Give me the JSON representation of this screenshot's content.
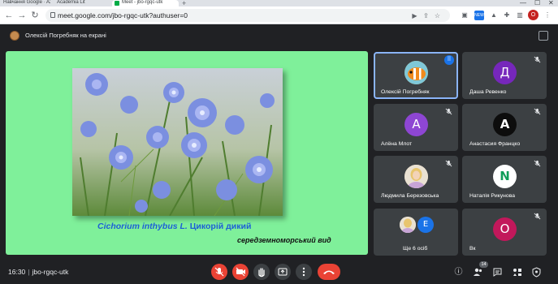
{
  "browser": {
    "tabs": [
      {
        "label": "Навчання Google · Azure"
      },
      {
        "label": "Academia Lit"
      },
      {
        "label": "Meet - jbo-rgqc-utk",
        "active": true
      }
    ],
    "new_tab": "+",
    "url": "meet.google.com/jbo-rgqc-utk?authuser=0",
    "profile_initial": "О"
  },
  "presenter_bar": {
    "text": "Олексій Погребняк на екрані"
  },
  "presentation": {
    "caption_latin": "Cichorium inthybus L.",
    "caption_native": "Цикорій дикий",
    "subcaption": "середземноморський вид"
  },
  "participants": [
    {
      "name": "Олексій Погребняк",
      "avatar": "photo",
      "speaking": true
    },
    {
      "name": "Даша Ревенко",
      "initial": "Д",
      "color": "#7627bb"
    },
    {
      "name": "Алёна Млот",
      "initial": "А",
      "color": "#8e46d3"
    },
    {
      "name": "Анастасия Францко",
      "initial": "A",
      "color": "#0d0d0d"
    },
    {
      "name": "Людмила Березовська",
      "avatar": "photo"
    },
    {
      "name": "Наталія Рикунова",
      "initial": "N",
      "color": "#ffffff"
    },
    {
      "name": "Ще 6 осіб",
      "initial": "E",
      "color": "#1a73e8"
    },
    {
      "name": "Вк",
      "initial": "О",
      "color": "#c2185b"
    }
  ],
  "bottom_bar": {
    "time": "16:30",
    "meeting_code": "jbo-rgqc-utk",
    "participant_count": "14"
  },
  "colors": {
    "accent": "#8ab4f8",
    "stage": "#7ff09a",
    "danger": "#ea4335",
    "surface": "#3c4043"
  }
}
